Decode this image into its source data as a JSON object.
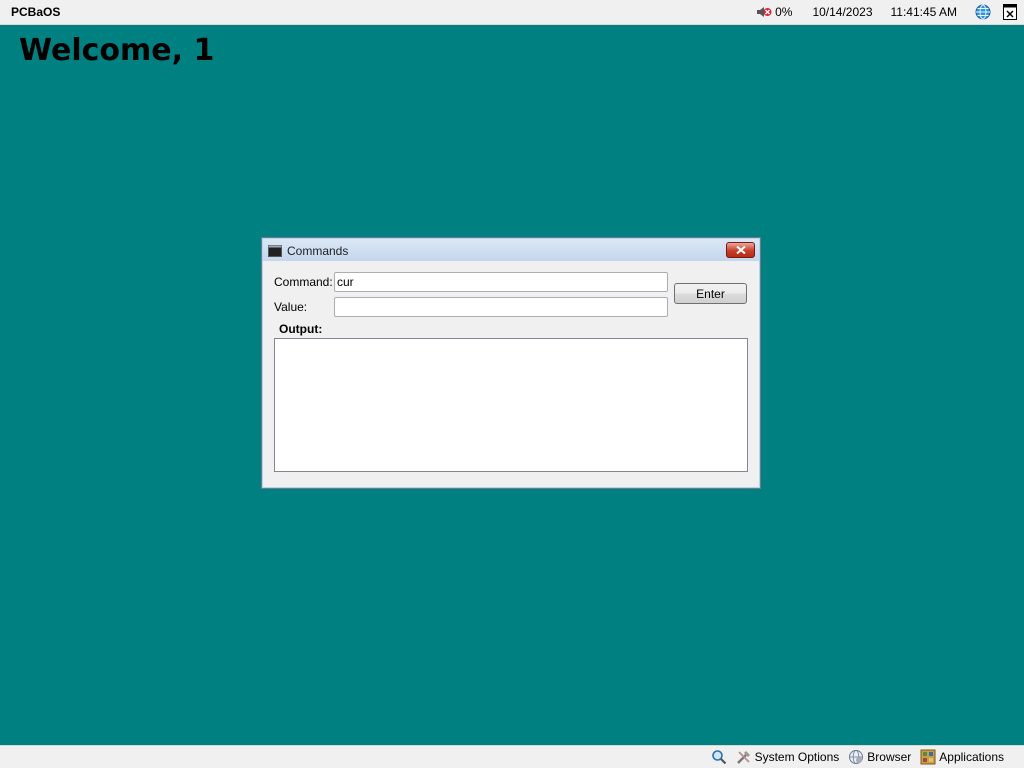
{
  "topbar": {
    "brand": "PCBaOS",
    "volume": "0%",
    "date": "10/14/2023",
    "time": "11:41:45 AM",
    "icons": [
      "volume-muted-icon",
      "globe-icon",
      "window-close-icon"
    ]
  },
  "welcome": "Welcome, 1",
  "dialog": {
    "title": "Commands",
    "command_label": "Command:",
    "command_value": "cur",
    "value_label": "Value:",
    "value_value": "",
    "enter_label": "Enter",
    "output_label": "Output:",
    "output_text": ""
  },
  "bottombar": {
    "system_options": "System Options",
    "browser": "Browser",
    "applications": "Applications",
    "icons": [
      "search-icon",
      "tools-icon",
      "browser-globe-icon",
      "applications-icon"
    ]
  },
  "colors": {
    "desktop": "#008080",
    "bar": "#f0f0f0"
  }
}
